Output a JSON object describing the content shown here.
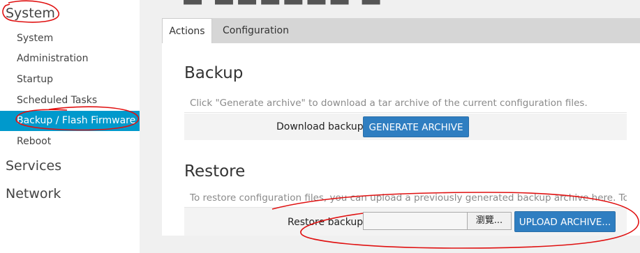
{
  "sidebar": {
    "system_heading": "System",
    "items": [
      {
        "label": "System"
      },
      {
        "label": "Administration"
      },
      {
        "label": "Startup"
      },
      {
        "label": "Scheduled Tasks"
      },
      {
        "label": "Backup / Flash Firmware"
      },
      {
        "label": "Reboot"
      }
    ],
    "services_heading": "Services",
    "network_heading": "Network"
  },
  "tabs": [
    {
      "label": "Actions"
    },
    {
      "label": "Configuration"
    }
  ],
  "backup": {
    "title": "Backup",
    "description": "Click \"Generate archive\" to download a tar archive of the current configuration files.",
    "download_label": "Download backup:",
    "generate_button": "GENERATE ARCHIVE"
  },
  "restore": {
    "title": "Restore",
    "description": "To restore configuration files, you can upload a previously generated backup archive here. To rese",
    "restore_label": "Restore backup:",
    "browse_button": "瀏覽...",
    "upload_button": "UPLOAD ARCHIVE..."
  },
  "colors": {
    "active_item": "#0099cc",
    "primary_button": "#2f7ec1",
    "annotation": "#e01010"
  }
}
